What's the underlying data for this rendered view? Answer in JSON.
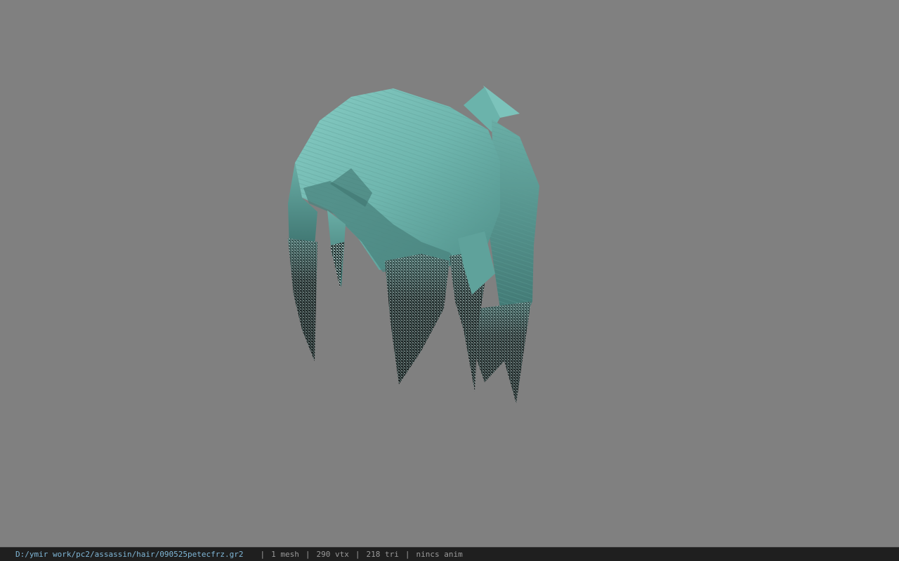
{
  "viewport": {
    "background_color": "#808080",
    "model": {
      "description_icon": "hair-mesh",
      "primary_color": "#6fb8b0",
      "shadow_color": "#3f7a76",
      "tip_color": "#1e2a2a"
    }
  },
  "statusbar": {
    "file_path": "D:/ymir work/pc2/assassin/hair/090525petecfrz.gr2",
    "separator": "|",
    "mesh_count": "1 mesh",
    "vertex_count": "290 vtx",
    "triangle_count": "218 tri",
    "anim_status": "nincs anim",
    "path_color": "#7fb6d6",
    "text_color": "#9a9a9a"
  }
}
